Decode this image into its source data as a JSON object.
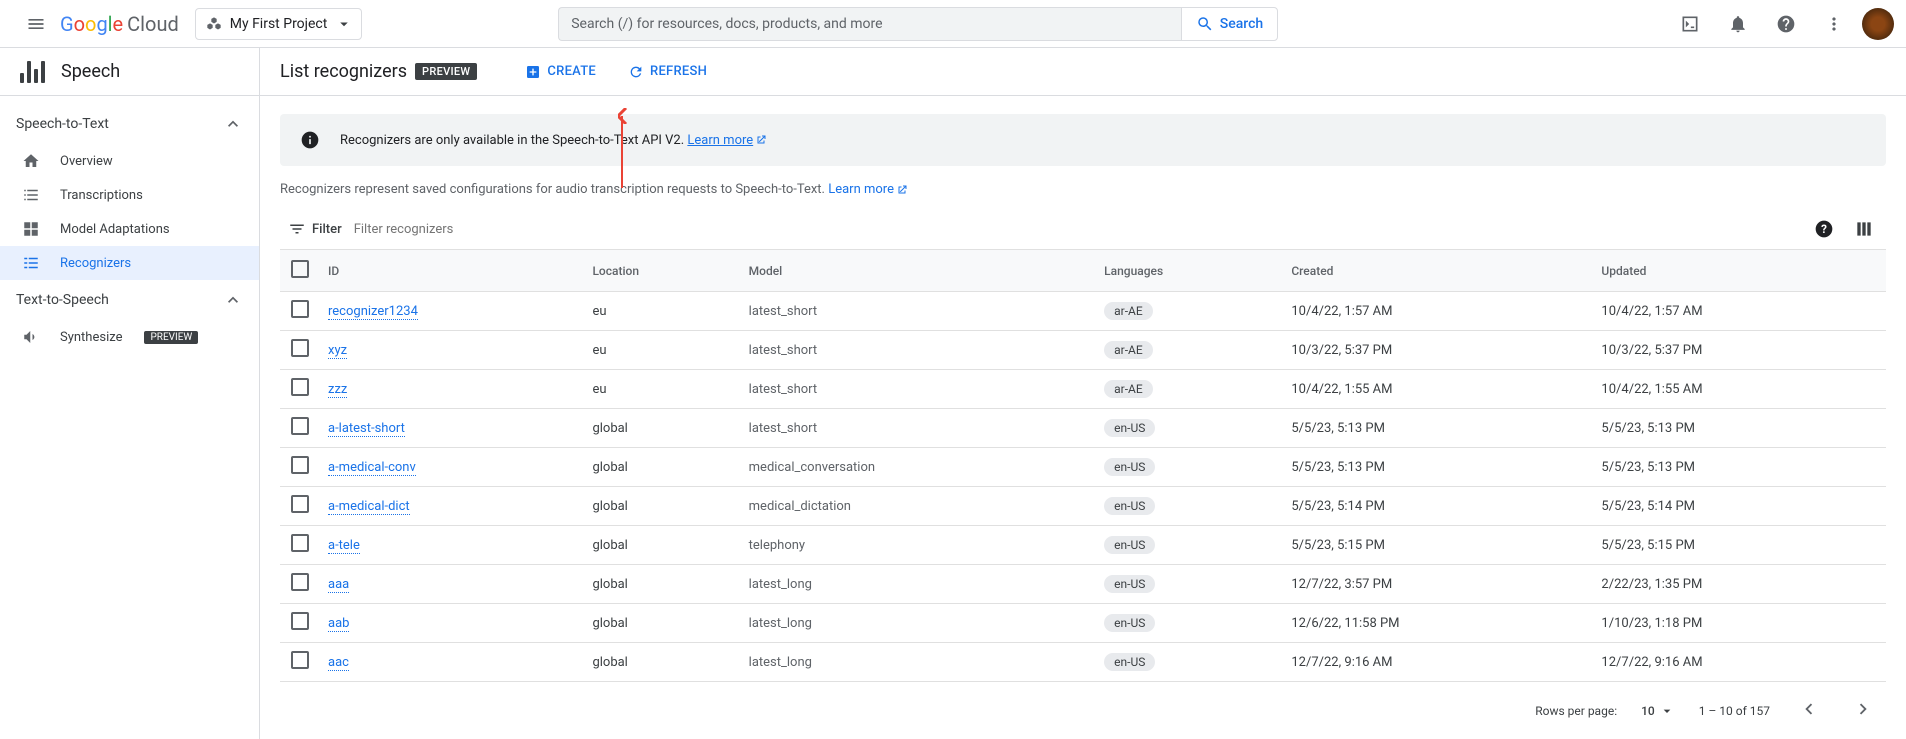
{
  "header": {
    "project": "My First Project",
    "search_placeholder": "Search (/) for resources, docs, products, and more",
    "search_btn": "Search",
    "cloud_text": "Cloud"
  },
  "product": {
    "name": "Speech"
  },
  "page": {
    "title": "List recognizers",
    "badge": "PREVIEW",
    "create_btn": "CREATE",
    "refresh_btn": "REFRESH"
  },
  "sidebar": {
    "group1": "Speech-to-Text",
    "group2": "Text-to-Speech",
    "items": {
      "overview": "Overview",
      "transcriptions": "Transcriptions",
      "adaptations": "Model Adaptations",
      "recognizers": "Recognizers",
      "synthesize": "Synthesize",
      "synth_badge": "PREVIEW"
    }
  },
  "banner": {
    "text": "Recognizers are only available in the Speech-to-Text API V2. ",
    "link": "Learn more"
  },
  "desc": {
    "text": "Recognizers represent saved configurations for audio transcription requests to Speech-to-Text. ",
    "link": "Learn more"
  },
  "filter": {
    "label": "Filter",
    "placeholder": "Filter recognizers"
  },
  "columns": {
    "id": "ID",
    "location": "Location",
    "model": "Model",
    "languages": "Languages",
    "created": "Created",
    "updated": "Updated"
  },
  "rows": [
    {
      "id": "recognizer1234",
      "location": "eu",
      "model": "latest_short",
      "lang": "ar-AE",
      "created": "10/4/22, 1:57 AM",
      "updated": "10/4/22, 1:57 AM"
    },
    {
      "id": "xyz",
      "location": "eu",
      "model": "latest_short",
      "lang": "ar-AE",
      "created": "10/3/22, 5:37 PM",
      "updated": "10/3/22, 5:37 PM"
    },
    {
      "id": "zzz",
      "location": "eu",
      "model": "latest_short",
      "lang": "ar-AE",
      "created": "10/4/22, 1:55 AM",
      "updated": "10/4/22, 1:55 AM"
    },
    {
      "id": "a-latest-short",
      "location": "global",
      "model": "latest_short",
      "lang": "en-US",
      "created": "5/5/23, 5:13 PM",
      "updated": "5/5/23, 5:13 PM"
    },
    {
      "id": "a-medical-conv",
      "location": "global",
      "model": "medical_conversation",
      "lang": "en-US",
      "created": "5/5/23, 5:13 PM",
      "updated": "5/5/23, 5:13 PM"
    },
    {
      "id": "a-medical-dict",
      "location": "global",
      "model": "medical_dictation",
      "lang": "en-US",
      "created": "5/5/23, 5:14 PM",
      "updated": "5/5/23, 5:14 PM"
    },
    {
      "id": "a-tele",
      "location": "global",
      "model": "telephony",
      "lang": "en-US",
      "created": "5/5/23, 5:15 PM",
      "updated": "5/5/23, 5:15 PM"
    },
    {
      "id": "aaa",
      "location": "global",
      "model": "latest_long",
      "lang": "en-US",
      "created": "12/7/22, 3:57 PM",
      "updated": "2/22/23, 1:35 PM"
    },
    {
      "id": "aab",
      "location": "global",
      "model": "latest_long",
      "lang": "en-US",
      "created": "12/6/22, 11:58 PM",
      "updated": "1/10/23, 1:18 PM"
    },
    {
      "id": "aac",
      "location": "global",
      "model": "latest_long",
      "lang": "en-US",
      "created": "12/7/22, 9:16 AM",
      "updated": "12/7/22, 9:16 AM"
    }
  ],
  "pager": {
    "rpp_label": "Rows per page:",
    "rpp_value": "10",
    "range": "1 – 10 of 157"
  }
}
